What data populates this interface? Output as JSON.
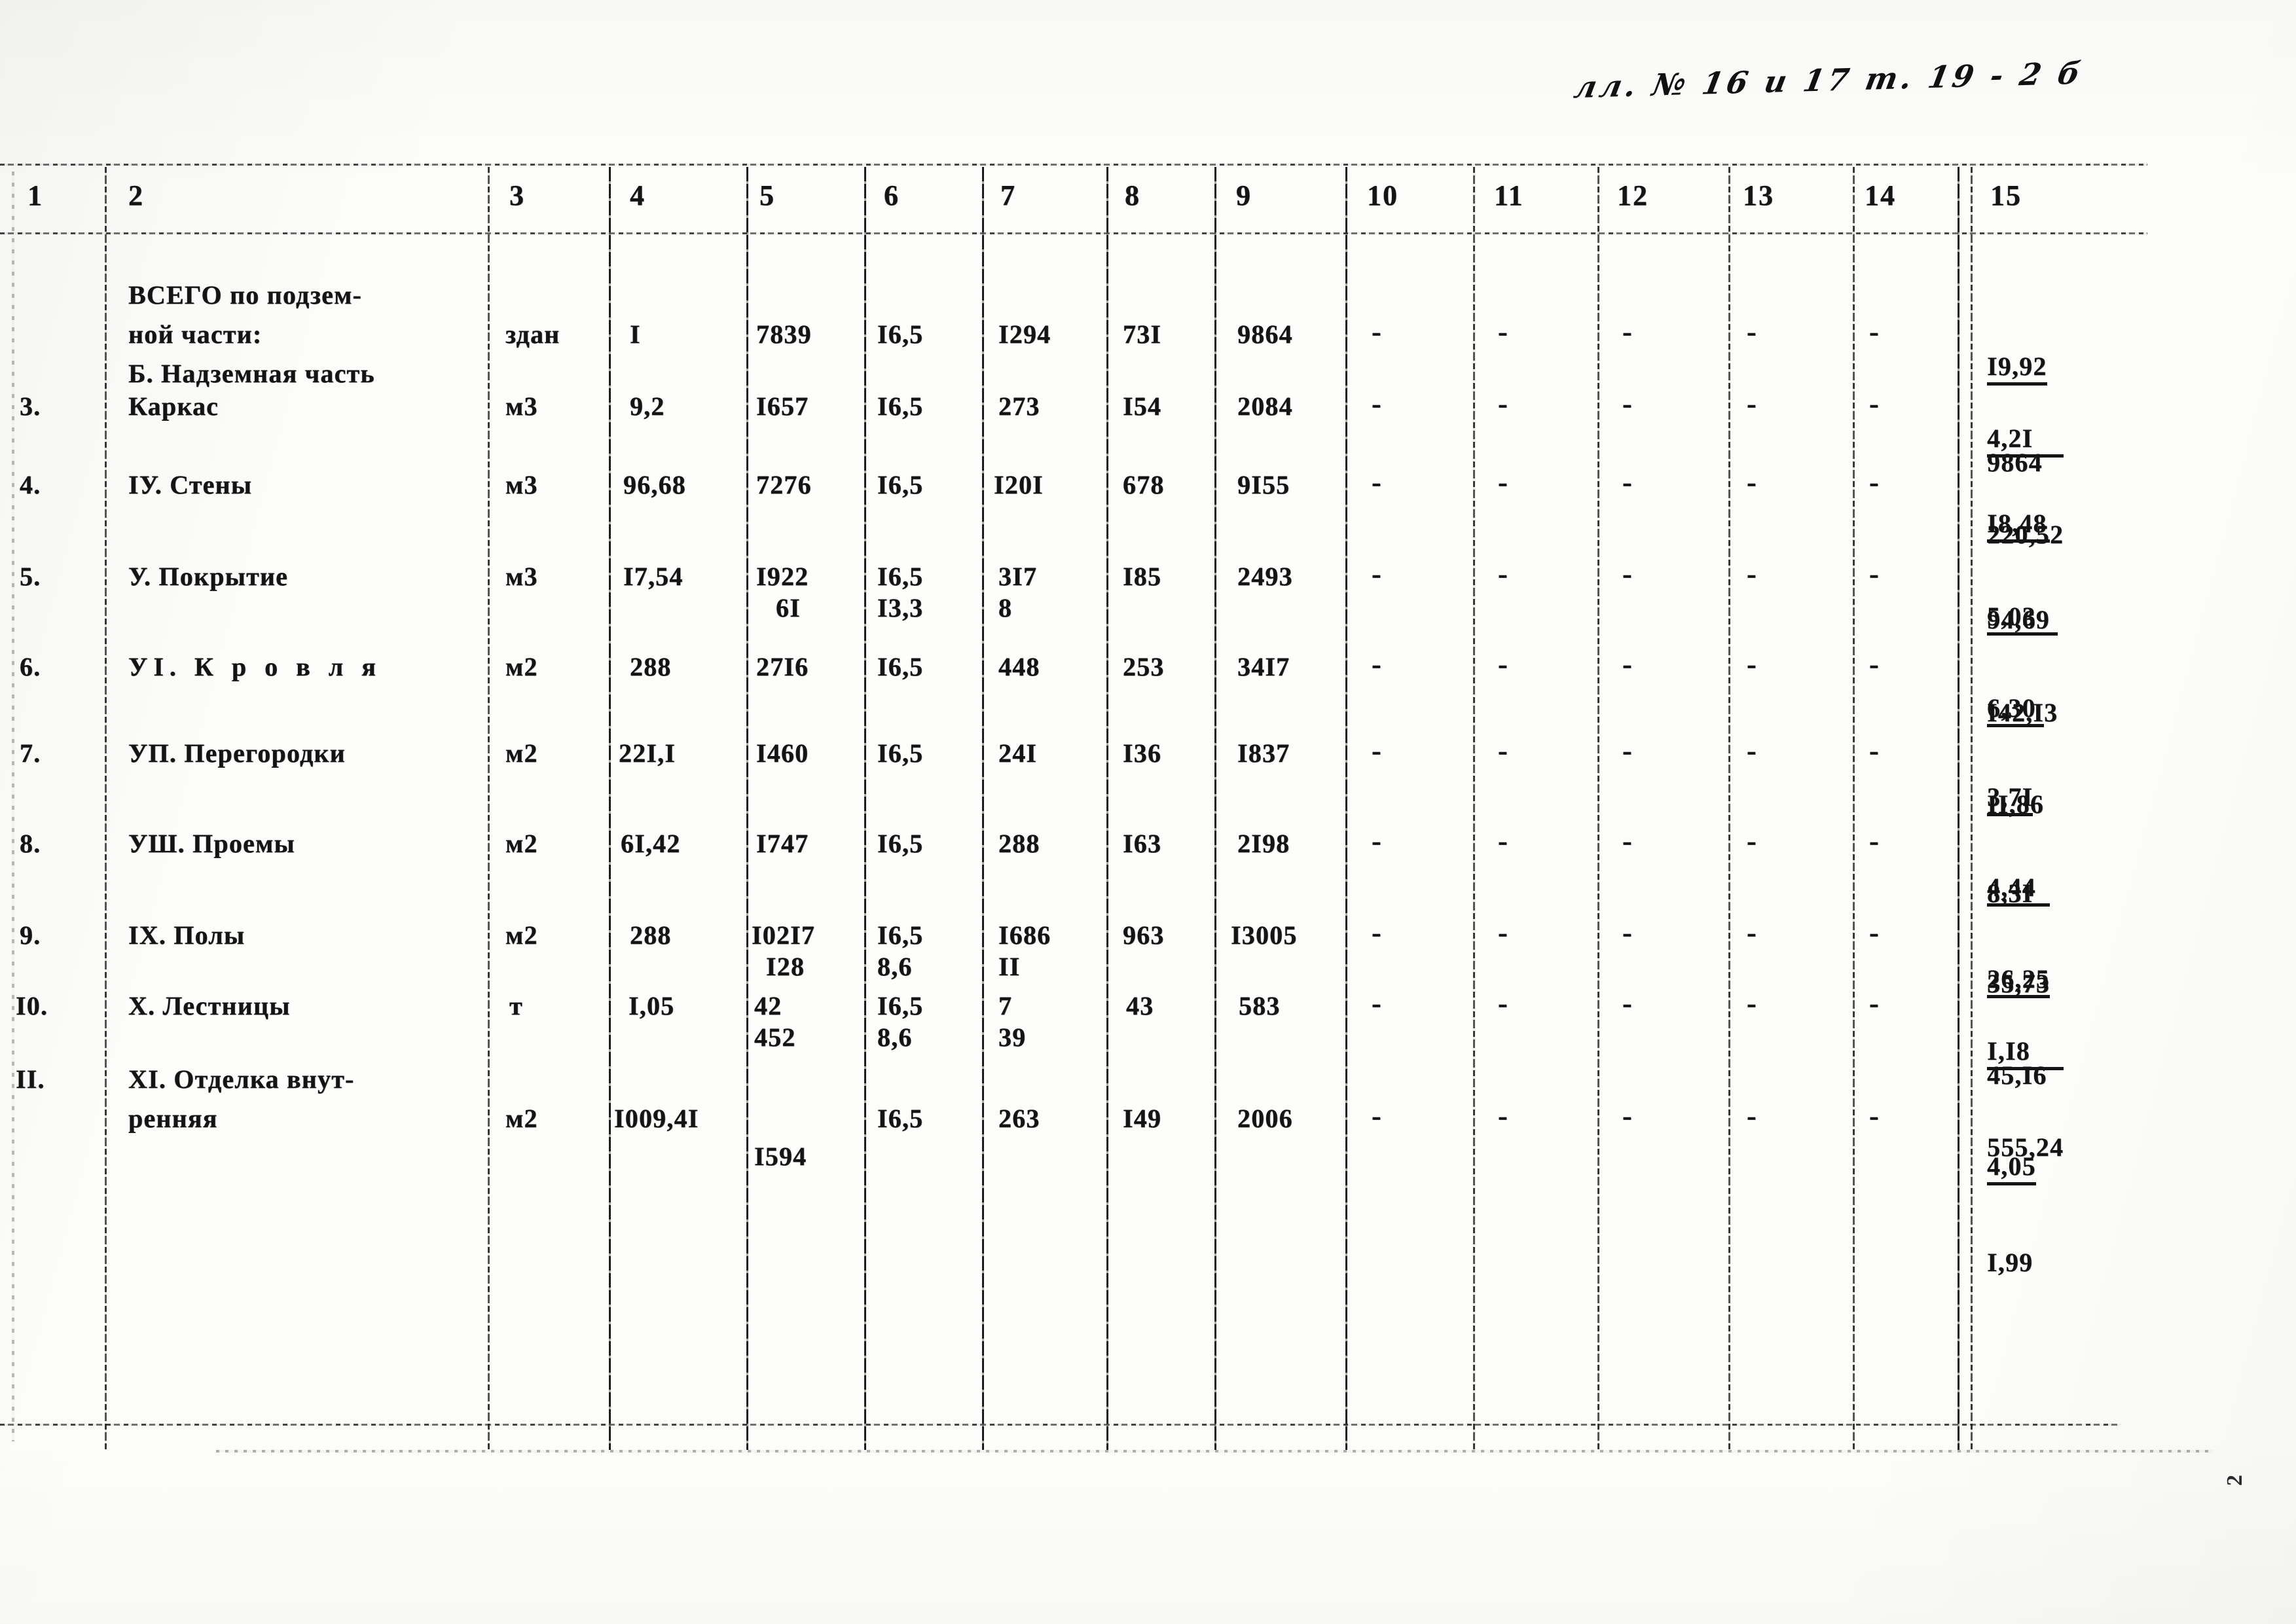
{
  "annotation": {
    "handwritten_note": "лл. № 16 и 17 т. 19 - 2 б",
    "page_marker": "2"
  },
  "table": {
    "column_headers": [
      "1",
      "2",
      "3",
      "4",
      "5",
      "6",
      "7",
      "8",
      "9",
      "10",
      "11",
      "12",
      "13",
      "14",
      "15"
    ],
    "rows": [
      {
        "no": "",
        "name_line1": "ВСЕГО по подзем-",
        "name_line2": "ной части:",
        "c3": "здан",
        "c4": "I",
        "c5": "7839",
        "c5b": "",
        "c6": "I6,5",
        "c6b": "",
        "c7": "I294",
        "c7b": "",
        "c8": "73I",
        "c9": "9864",
        "c10": "-",
        "c11": "-",
        "c12": "-",
        "c13": "-",
        "c14": "-",
        "c15_num": "I9,92",
        "c15_den": "9864"
      },
      {
        "no": "",
        "name_line1": "Б. Надземная часть",
        "name_line2": "",
        "c3": "",
        "c4": "",
        "c5": "",
        "c5b": "",
        "c6": "",
        "c6b": "",
        "c7": "",
        "c7b": "",
        "c8": "",
        "c9": "",
        "c10": "",
        "c11": "",
        "c12": "",
        "c13": "",
        "c14": "",
        "c15_num": "",
        "c15_den": ""
      },
      {
        "no": "3.",
        "name_line1": "Каркас",
        "name_line2": "",
        "c3": "м3",
        "c4": "9,2",
        "c5": "I657",
        "c5b": "",
        "c6": "I6,5",
        "c6b": "",
        "c7": "273",
        "c7b": "",
        "c8": "I54",
        "c9": "2084",
        "c10": "-",
        "c11": "-",
        "c12": "-",
        "c13": "-",
        "c14": "-",
        "c15_num": "4,2I",
        "c15_den": "220,52"
      },
      {
        "no": "4.",
        "name_line1": "IУ. Стены",
        "name_line2": "",
        "c3": "м3",
        "c4": "96,68",
        "c5": "7276",
        "c5b": "",
        "c6": "I6,5",
        "c6b": "",
        "c7": "I20I",
        "c7b": "",
        "c8": "678",
        "c9": "9I55",
        "c10": "-",
        "c11": "-",
        "c12": "-",
        "c13": "-",
        "c14": "-",
        "c15_num": "I8,48",
        "c15_den": "94,69"
      },
      {
        "no": "5.",
        "name_line1": "У. Покрытие",
        "name_line2": "",
        "c3": "м3",
        "c4": "I7,54",
        "c5": "I922",
        "c5b": "6I",
        "c6": "I6,5",
        "c6b": "I3,3",
        "c7": "3I7",
        "c7b": "8",
        "c8": "I85",
        "c9": "2493",
        "c10": "-",
        "c11": "-",
        "c12": "-",
        "c13": "-",
        "c14": "-",
        "c15_num": "5,03",
        "c15_den": "I42,I3"
      },
      {
        "no": "6.",
        "name_line1": "УI. К р о в л я",
        "name_line2": "",
        "c3": "м2",
        "c4": "288",
        "c5": "27I6",
        "c5b": "",
        "c6": "I6,5",
        "c6b": "",
        "c7": "448",
        "c7b": "",
        "c8": "253",
        "c9": "34I7",
        "c10": "-",
        "c11": "-",
        "c12": "-",
        "c13": "-",
        "c14": "-",
        "c15_num": "6,30",
        "c15_den": "II,86"
      },
      {
        "no": "7.",
        "name_line1": "УП. Перегородки",
        "name_line2": "",
        "c3": "м2",
        "c4": "22I,I",
        "c5": "I460",
        "c5b": "",
        "c6": "I6,5",
        "c6b": "",
        "c7": "24I",
        "c7b": "",
        "c8": "I36",
        "c9": "I837",
        "c10": "-",
        "c11": "-",
        "c12": "-",
        "c13": "-",
        "c14": "-",
        "c15_num": "3,7I",
        "c15_den": "8,3I"
      },
      {
        "no": "8.",
        "name_line1": "УШ. Проемы",
        "name_line2": "",
        "c3": "м2",
        "c4": "6I,42",
        "c5": "I747",
        "c5b": "",
        "c6": "I6,5",
        "c6b": "",
        "c7": "288",
        "c7b": "",
        "c8": "I63",
        "c9": "2I98",
        "c10": "-",
        "c11": "-",
        "c12": "-",
        "c13": "-",
        "c14": "-",
        "c15_num": "4,44",
        "c15_den": "35,73"
      },
      {
        "no": "9.",
        "name_line1": "IХ. Полы",
        "name_line2": "",
        "c3": "м2",
        "c4": "288",
        "c5": "I02I7",
        "c5b": "I28",
        "c6": "I6,5",
        "c6b": "8,6",
        "c7": "I686",
        "c7b": "II",
        "c8": "963",
        "c9": "I3005",
        "c10": "-",
        "c11": "-",
        "c12": "-",
        "c13": "-",
        "c14": "-",
        "c15_num": "26,25",
        "c15_den": "45,I6"
      },
      {
        "no": "I0.",
        "name_line1": "Х. Лестницы",
        "name_line2": "",
        "c3": "т",
        "c4": "I,05",
        "c5": "42",
        "c5b": "452",
        "c6": "I6,5",
        "c6b": "8,6",
        "c7": "7",
        "c7b": "39",
        "c8": "43",
        "c9": "583",
        "c10": "-",
        "c11": "-",
        "c12": "-",
        "c13": "-",
        "c14": "-",
        "c15_num": "I,I8",
        "c15_den": "555,24"
      },
      {
        "no": "II.",
        "name_line1": "ХI. Отделка внут-",
        "name_line2": "ренняя",
        "c3": "м2",
        "c4": "I009,4I",
        "c5": "",
        "c5b": "I594",
        "c6": "I6,5",
        "c6b": "",
        "c7": "263",
        "c7b": "",
        "c8": "I49",
        "c9": "2006",
        "c10": "-",
        "c11": "-",
        "c12": "-",
        "c13": "-",
        "c14": "-",
        "c15_num": "4,05",
        "c15_den": "I,99"
      }
    ]
  }
}
